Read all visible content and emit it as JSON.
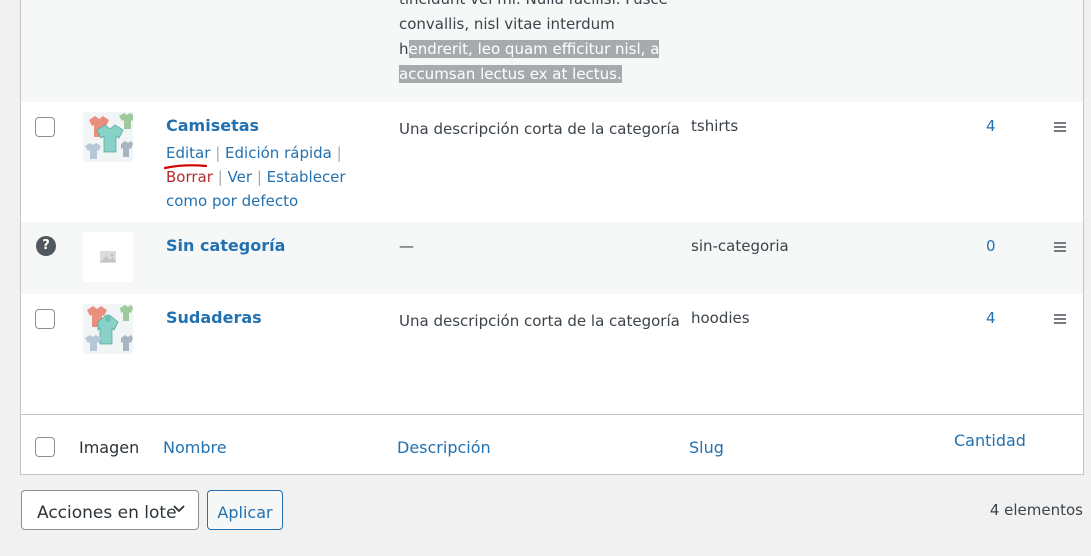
{
  "top_row": {
    "description_lines": [
      "tincidunt vel mi. Nulla facilisi. Fusce",
      "convallis, nisl vitae interdum",
      "h",
      "endrerit, leo quam efficitur nisl, a",
      "accumsan lectus ex at lectus."
    ]
  },
  "rows": [
    {
      "name": "Camisetas",
      "description": "Una descripción corta de la categoría",
      "slug": "tshirts",
      "count": "4",
      "actions": {
        "edit": "Editar",
        "quick_edit": "Edición rápida",
        "delete": "Borrar",
        "view": "Ver",
        "set_default": "Establecer como por defecto",
        "sep": "|"
      }
    },
    {
      "name": "Sin categoría",
      "description": "—",
      "slug": "sin-categoria",
      "count": "0",
      "icon": "help-icon",
      "icon_glyph": "?"
    },
    {
      "name": "Sudaderas",
      "description": "Una descripción corta de la categoría",
      "slug": "hoodies",
      "count": "4"
    }
  ],
  "footer": {
    "col_image": "Imagen",
    "col_name": "Nombre",
    "col_description": "Descripción",
    "col_slug": "Slug",
    "col_count": "Cantidad"
  },
  "bulk_actions": {
    "select_label": "Acciones en lote",
    "apply_label": "Aplicar"
  },
  "item_count": "4 elementos",
  "colors": {
    "link": "#2271b1",
    "delete": "#b32d2e",
    "annotation_underline": "#d00000"
  }
}
